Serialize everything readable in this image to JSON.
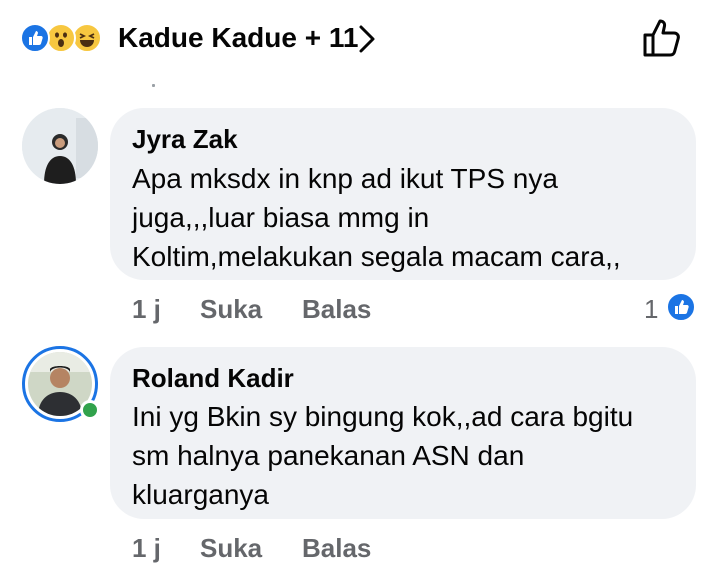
{
  "header": {
    "reactors_text": "Kadue Kadue + 11",
    "reaction_icons": [
      "like-icon",
      "wow-icon",
      "haha-icon"
    ]
  },
  "comments": [
    {
      "author": "Jyra Zak",
      "lines": [
        "Apa mksdx in knp ad ikut TPS nya",
        "juga,,,luar biasa mmg in",
        "Koltim,melakukan segala macam cara,,"
      ],
      "time": "1 j",
      "like_label": "Suka",
      "reply_label": "Balas",
      "reaction_count": "1"
    },
    {
      "author": "Roland Kadir",
      "lines": [
        "Ini yg Bkin sy bingung kok,,ad cara bgitu",
        "sm halnya panekanan ASN dan",
        "kluarganya"
      ],
      "time": "1 j",
      "like_label": "Suka",
      "reply_label": "Balas"
    }
  ],
  "colors": {
    "accent": "#1b74e4",
    "bubble": "#f0f2f5",
    "secondary_text": "#65676b",
    "online": "#31a24c"
  }
}
